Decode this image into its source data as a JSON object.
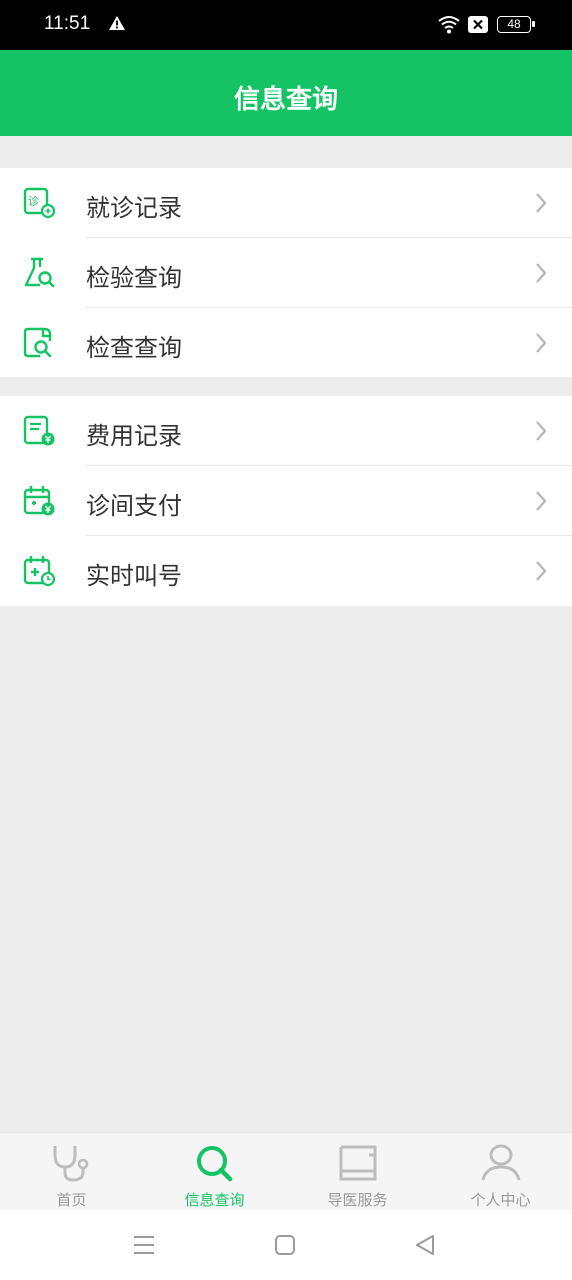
{
  "status": {
    "time": "11:51",
    "battery": "48"
  },
  "header": {
    "title": "信息查询"
  },
  "group1": [
    {
      "label": "就诊记录",
      "icon": "visit-record-icon"
    },
    {
      "label": "检验查询",
      "icon": "flask-search-icon"
    },
    {
      "label": "检查查询",
      "icon": "document-search-icon"
    }
  ],
  "group2": [
    {
      "label": "费用记录",
      "icon": "fee-record-icon"
    },
    {
      "label": "诊间支付",
      "icon": "calendar-pay-icon"
    },
    {
      "label": "实时叫号",
      "icon": "calendar-clock-icon"
    }
  ],
  "tabs": [
    {
      "label": "首页",
      "icon": "stethoscope-icon",
      "active": false
    },
    {
      "label": "信息查询",
      "icon": "search-icon",
      "active": true
    },
    {
      "label": "导医服务",
      "icon": "book-icon",
      "active": false
    },
    {
      "label": "个人中心",
      "icon": "user-icon",
      "active": false
    }
  ],
  "colors": {
    "primary": "#14c464",
    "background": "#ededed",
    "text": "#333333",
    "tab_inactive": "#999999"
  }
}
